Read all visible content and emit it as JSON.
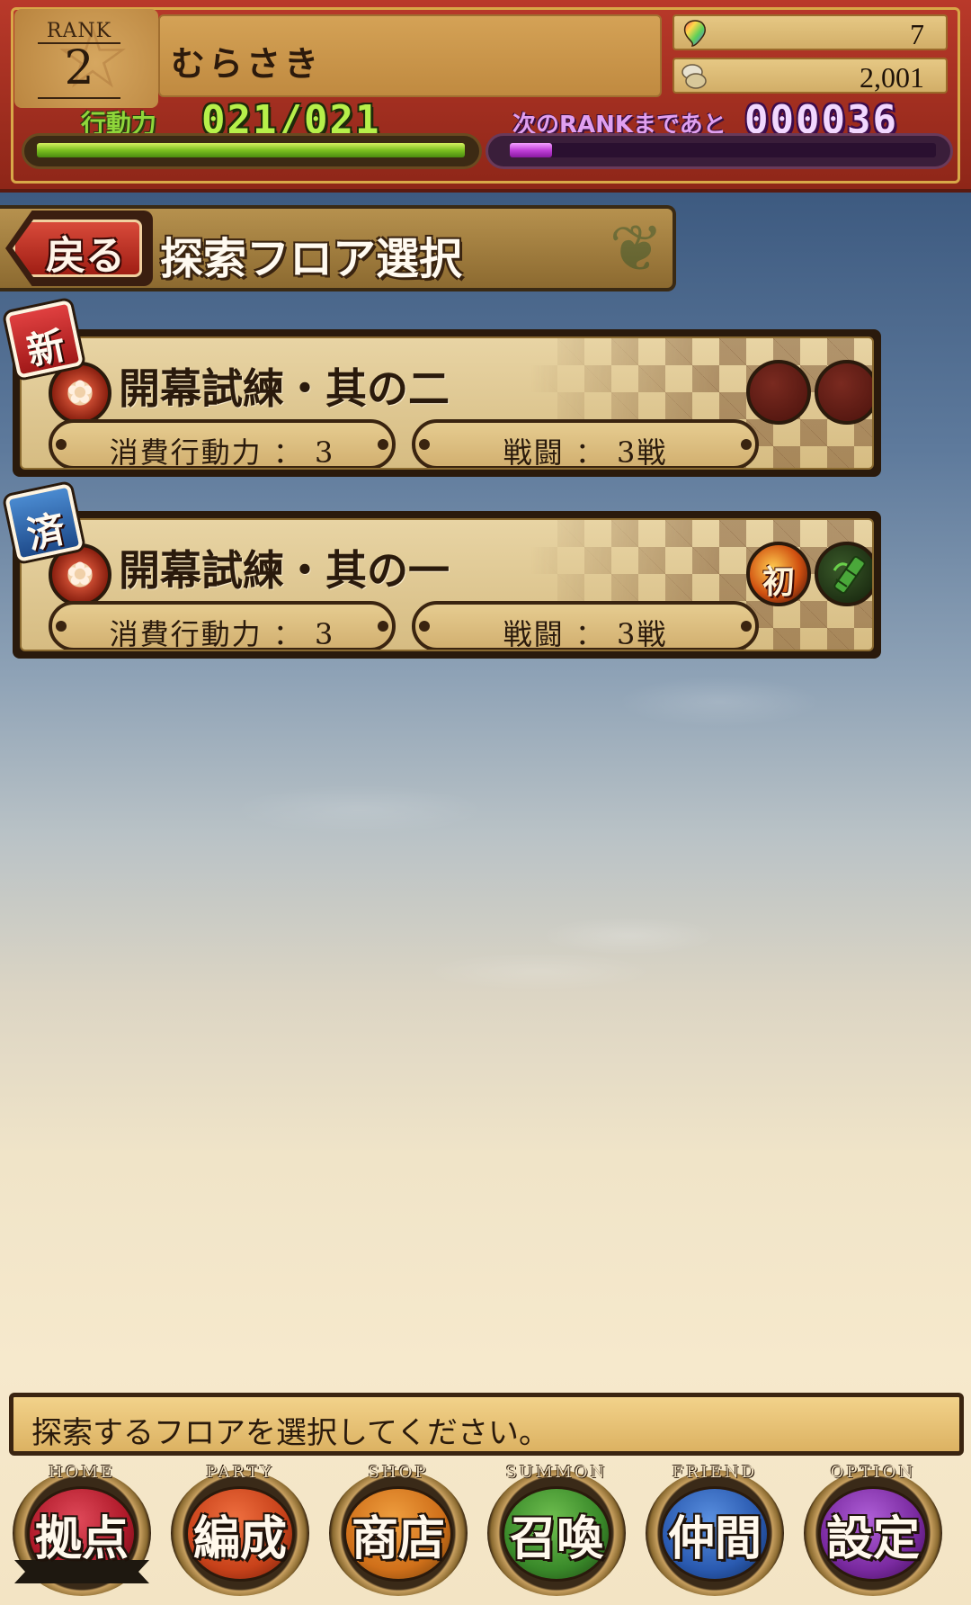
{
  "header": {
    "rank_label": "RANK",
    "rank_value": "2",
    "player_name": "むらさき",
    "gems": "7",
    "coins": "2,001",
    "ap_label": "行動力",
    "ap_value": "021/021",
    "ap_fraction": 1.0,
    "next_rank_label": "次のRANKまであと",
    "next_rank_value": "000036",
    "xp_fraction": 0.1
  },
  "title_bar": {
    "back_label": "戻る",
    "title": "探索フロア選択"
  },
  "floors": [
    {
      "badge": "新",
      "name": "開幕試練・其の二",
      "cost": "消費行動力 ： 3",
      "battles": "戦闘 ： 3戦",
      "crest_icon": "family-crest-icon",
      "slots": [
        "empty-slot",
        "empty-slot"
      ]
    },
    {
      "badge": "済",
      "name": "開幕試練・其の一",
      "cost": "消費行動力 ： 3",
      "battles": "戦闘 ： 3戦",
      "crest_icon": "family-crest-icon",
      "first_clear_label": "初",
      "slots": [
        "first-clear-icon",
        "bamboo-item-icon"
      ]
    }
  ],
  "message": "探索するフロアを選択してください。",
  "nav": [
    {
      "sub": "HOME",
      "label": "拠点",
      "color": "#b01a2a"
    },
    {
      "sub": "PARTY",
      "label": "編成",
      "color": "#c8421a"
    },
    {
      "sub": "SHOP",
      "label": "商店",
      "color": "#d0701a"
    },
    {
      "sub": "SUMMON",
      "label": "召喚",
      "color": "#3a8a2a"
    },
    {
      "sub": "FRIEND",
      "label": "仲間",
      "color": "#2a5ab0"
    },
    {
      "sub": "OPTION",
      "label": "設定",
      "color": "#7a2aa0"
    }
  ]
}
